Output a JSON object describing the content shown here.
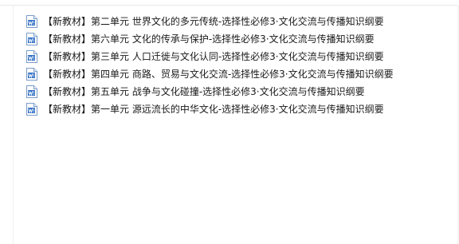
{
  "header": {
    "columns": [
      "",
      "",
      ""
    ]
  },
  "files": [
    {
      "name": "【新教材】第二单元  世界文化的多元传统-选择性必修3·文化交流与传播知识纲要",
      "icon": "word-doc-icon"
    },
    {
      "name": "【新教材】第六单元  文化的传承与保护-选择性必修3·文化交流与传播知识纲要",
      "icon": "word-doc-icon"
    },
    {
      "name": "【新教材】第三单元  人口迁徙与文化认同-选择性必修3·文化交流与传播知识纲要",
      "icon": "word-doc-icon"
    },
    {
      "name": "【新教材】第四单元  商路、贸易与文化交流-选择性必修3·文化交流与传播知识纲要",
      "icon": "word-doc-icon"
    },
    {
      "name": "【新教材】第五单元  战争与文化碰撞-选择性必修3·文化交流与传播知识纲要",
      "icon": "word-doc-icon"
    },
    {
      "name": "【新教材】第一单元  源远流长的中华文化-选择性必修3·文化交流与传播知识纲要",
      "icon": "word-doc-icon"
    }
  ],
  "colors": {
    "icon_blue": "#2b6cc4",
    "icon_border": "#7a9cc8",
    "text": "#1a1a1a"
  }
}
